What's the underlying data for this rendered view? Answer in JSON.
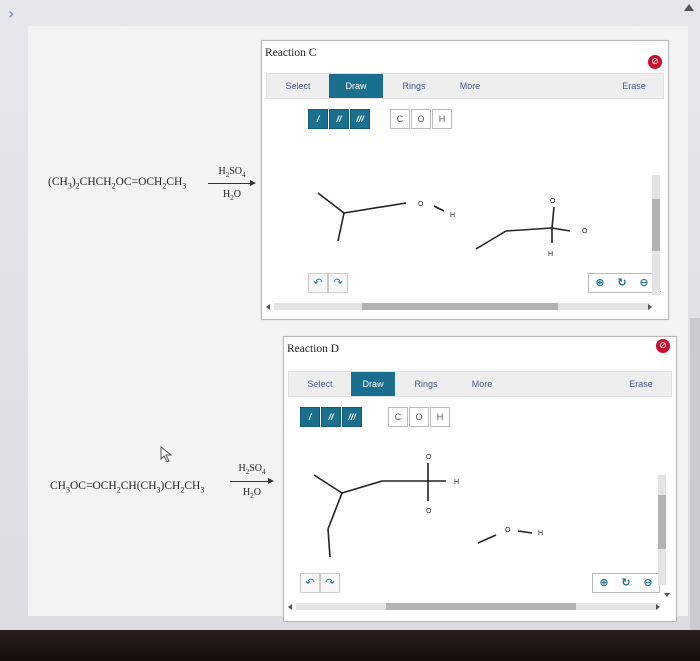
{
  "reactions": [
    {
      "reactant_parts": [
        "(CH",
        "3",
        ")",
        "2",
        "CHCH",
        "2",
        "OC=OCH",
        "2",
        "CH",
        "3"
      ],
      "reagent_top": [
        "H",
        "2",
        "SO",
        "4"
      ],
      "reagent_bottom": [
        "H",
        "2",
        "O"
      ]
    },
    {
      "reactant_parts": [
        "CH",
        "3",
        "OC=OCH",
        "2",
        "CH(CH",
        "3",
        ")CH",
        "2",
        "CH",
        "3"
      ],
      "reagent_top": [
        "H",
        "2",
        "SO",
        "4"
      ],
      "reagent_bottom": [
        "H",
        "2",
        "O"
      ]
    }
  ],
  "panels": [
    {
      "title": "Reaction C",
      "tabs": [
        "Select",
        "Draw",
        "Rings",
        "More",
        "Erase"
      ],
      "bond_tools": [
        "/",
        "//",
        "///"
      ],
      "atom_tools": [
        "C",
        "O",
        "H"
      ],
      "atom_labels": {
        "o1": "O",
        "h1": "H",
        "o2": "O",
        "o3": "O",
        "h2": "H"
      }
    },
    {
      "title": "Reaction D",
      "tabs": [
        "Select",
        "Draw",
        "Rings",
        "More",
        "Erase"
      ],
      "bond_tools": [
        "/",
        "//",
        "///"
      ],
      "atom_tools": [
        "C",
        "O",
        "H"
      ],
      "atom_labels": {
        "o1": "O",
        "h1": "H",
        "o2": "O",
        "o3": "O",
        "h2": "H"
      }
    }
  ],
  "icons": {
    "delete": "⊘",
    "undo": "↶",
    "redo": "↷",
    "zoom_in": "⊕",
    "zoom_reset": "↻",
    "zoom_out": "⊖",
    "chevron": "›"
  },
  "colors": {
    "accent": "#1a6f8e",
    "delete_red": "#c8102e",
    "tab_text": "#4a5a8a"
  }
}
